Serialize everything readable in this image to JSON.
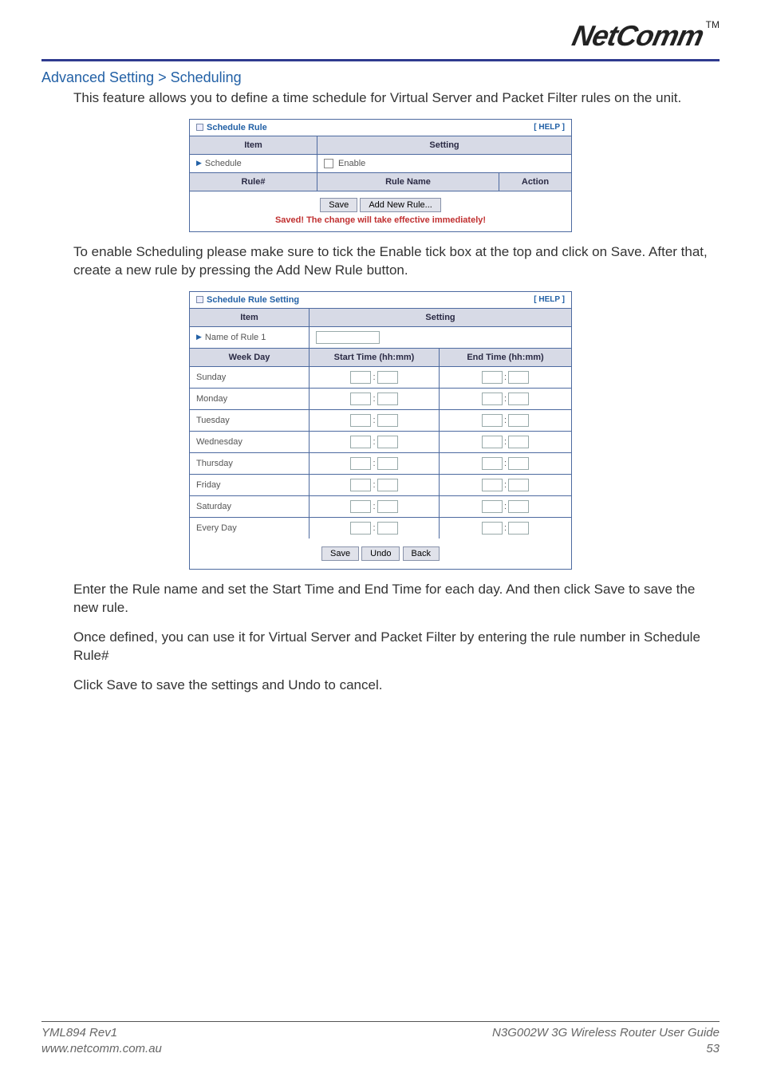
{
  "logo": {
    "text": "NetComm",
    "tm": "TM"
  },
  "title": "Advanced Setting > Scheduling",
  "intro": "This feature allows you to define a time schedule for Virtual Server and Packet Filter rules on the unit.",
  "panel1": {
    "title": "Schedule Rule",
    "help": "[ HELP ]",
    "headers": {
      "item": "Item",
      "setting": "Setting",
      "ruleNum": "Rule#",
      "ruleName": "Rule Name",
      "action": "Action"
    },
    "scheduleLabel": "Schedule",
    "enableLabel": "Enable",
    "buttons": {
      "save": "Save",
      "addNew": "Add New Rule..."
    },
    "savedMsg": "Saved! The change will take effective immediately!"
  },
  "mid1": "To enable Scheduling please make sure to tick the Enable tick box at the top and click on Save. After that, create a new rule by pressing the Add New Rule button.",
  "panel2": {
    "title": "Schedule Rule Setting",
    "help": "[ HELP ]",
    "headers": {
      "item": "Item",
      "setting": "Setting",
      "weekday": "Week Day",
      "start": "Start Time (hh:mm)",
      "end": "End Time (hh:mm)"
    },
    "nameLabel": "Name of Rule 1",
    "days": [
      "Sunday",
      "Monday",
      "Tuesday",
      "Wednesday",
      "Thursday",
      "Friday",
      "Saturday",
      "Every Day"
    ],
    "buttons": {
      "save": "Save",
      "undo": "Undo",
      "back": "Back"
    }
  },
  "outro1": "Enter the Rule name and set the Start Time and End Time for each day. And then click Save to save the new rule.",
  "outro2": "Once defined, you can use it for Virtual Server and Packet Filter by entering the rule number in Schedule Rule#",
  "outro3": "Click Save to save the settings and Undo to cancel.",
  "footer": {
    "leftTop": "YML894 Rev1",
    "leftBottom": "www.netcomm.com.au",
    "rightTop": "N3G002W 3G Wireless Router User Guide",
    "rightBottom": "53"
  }
}
